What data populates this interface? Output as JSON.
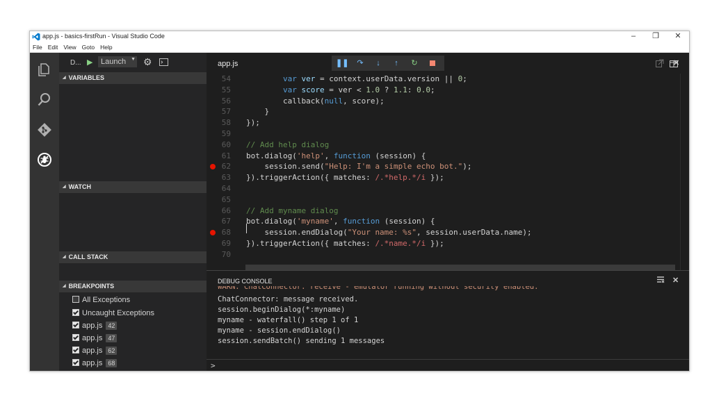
{
  "window": {
    "title": "app.js - basics-firstRun - Visual Studio Code",
    "controls": {
      "minimize": "–",
      "maximize": "❐",
      "close": "✕"
    },
    "accent": "#0079cc"
  },
  "menu": [
    "File",
    "Edit",
    "View",
    "Goto",
    "Help"
  ],
  "activity_bar": [
    "explorer-icon",
    "search-icon",
    "git-icon",
    "debug-icon"
  ],
  "debug_sidebar": {
    "view_label": "D...",
    "config": "Launch",
    "sections": {
      "variables": "VARIABLES",
      "watch": "WATCH",
      "call_stack": "CALL STACK",
      "breakpoints": "BREAKPOINTS"
    },
    "breakpoints": [
      {
        "label": "All Exceptions",
        "checked": false,
        "line": null
      },
      {
        "label": "Uncaught Exceptions",
        "checked": true,
        "line": null
      },
      {
        "label": "app.js",
        "checked": true,
        "line": "42"
      },
      {
        "label": "app.js",
        "checked": true,
        "line": "47"
      },
      {
        "label": "app.js",
        "checked": true,
        "line": "62"
      },
      {
        "label": "app.js",
        "checked": true,
        "line": "68"
      }
    ]
  },
  "editor": {
    "tab": "app.js",
    "breakpoint_color": "#e51400",
    "lines": [
      {
        "n": "54",
        "bp": false,
        "tokens": [
          [
            "        ",
            ""
          ],
          [
            "var ",
            "kw"
          ],
          [
            "ver",
            "var"
          ],
          [
            " = context.userData.version || ",
            ""
          ],
          [
            "0",
            "num"
          ],
          [
            ";",
            ""
          ]
        ]
      },
      {
        "n": "55",
        "bp": false,
        "tokens": [
          [
            "        ",
            ""
          ],
          [
            "var ",
            "kw"
          ],
          [
            "score",
            "var"
          ],
          [
            " = ver < ",
            ""
          ],
          [
            "1.0",
            "num"
          ],
          [
            " ? ",
            ""
          ],
          [
            "1.1",
            "num"
          ],
          [
            ": ",
            ""
          ],
          [
            "0.0",
            "num"
          ],
          [
            ";",
            ""
          ]
        ]
      },
      {
        "n": "56",
        "bp": false,
        "tokens": [
          [
            "        callback(",
            ""
          ],
          [
            "null",
            "kw"
          ],
          [
            ", score);",
            ""
          ]
        ]
      },
      {
        "n": "57",
        "bp": false,
        "tokens": [
          [
            "    }",
            ""
          ]
        ]
      },
      {
        "n": "58",
        "bp": false,
        "tokens": [
          [
            "});",
            ""
          ]
        ]
      },
      {
        "n": "59",
        "bp": false,
        "tokens": []
      },
      {
        "n": "60",
        "bp": false,
        "tokens": [
          [
            "// Add help dialog",
            "cmt"
          ]
        ]
      },
      {
        "n": "61",
        "bp": false,
        "tokens": [
          [
            "bot.dialog(",
            ""
          ],
          [
            "'help'",
            "str"
          ],
          [
            ", ",
            ""
          ],
          [
            "function",
            "kw"
          ],
          [
            " (session) {",
            ""
          ]
        ]
      },
      {
        "n": "62",
        "bp": true,
        "tokens": [
          [
            "    session.send(",
            ""
          ],
          [
            "\"Help: I'm a simple echo bot.\"",
            "str"
          ],
          [
            ");",
            ""
          ]
        ]
      },
      {
        "n": "63",
        "bp": false,
        "tokens": [
          [
            "}).triggerAction({ matches: ",
            ""
          ],
          [
            "/.*help.*/i",
            "rx"
          ],
          [
            " });",
            ""
          ]
        ]
      },
      {
        "n": "64",
        "bp": false,
        "tokens": []
      },
      {
        "n": "65",
        "bp": false,
        "tokens": []
      },
      {
        "n": "66",
        "bp": false,
        "tokens": [
          [
            "// Add myname dialog",
            "cmt"
          ]
        ]
      },
      {
        "n": "67",
        "bp": false,
        "tokens": [
          [
            "bot.dialog(",
            ""
          ],
          [
            "'myname'",
            "str"
          ],
          [
            ", ",
            ""
          ],
          [
            "function",
            "kw"
          ],
          [
            " (session) {",
            ""
          ]
        ]
      },
      {
        "n": "68",
        "bp": true,
        "tokens": [
          [
            "    session.endDialog(",
            ""
          ],
          [
            "\"Your name: %s\"",
            "str"
          ],
          [
            ", session.userData.name);",
            ""
          ]
        ]
      },
      {
        "n": "69",
        "bp": false,
        "tokens": [
          [
            "}).triggerAction({ matches: ",
            ""
          ],
          [
            "/.*name.*/i",
            "rx"
          ],
          [
            " });",
            ""
          ]
        ]
      },
      {
        "n": "70",
        "bp": false,
        "tokens": []
      }
    ]
  },
  "debug_console": {
    "title": "DEBUG CONSOLE",
    "warning_line": "WARN: ChatConnector: receive - emulator running without security enabled.",
    "lines": [
      "ChatConnector: message received.",
      "session.beginDialog(*:myname)",
      "myname - waterfall() step 1 of 1",
      "myname - session.endDialog()",
      "session.sendBatch() sending 1 messages"
    ],
    "prompt": ">"
  }
}
